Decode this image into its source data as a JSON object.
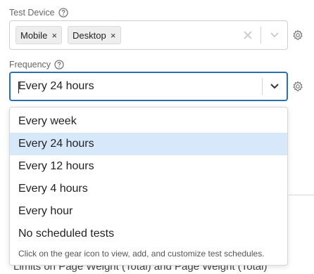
{
  "test_device": {
    "label": "Test Device",
    "tags": [
      "Mobile",
      "Desktop"
    ],
    "remove_glyph": "×"
  },
  "frequency": {
    "label": "Frequency",
    "value": "Every 24 hours",
    "options": [
      "Every week",
      "Every 24 hours",
      "Every 12 hours",
      "Every 4 hours",
      "Every hour",
      "No scheduled tests"
    ],
    "selected_index": 1,
    "hint": "Click on the gear icon to view, add, and customize test schedules."
  },
  "background_text": "Limits on Page Weight (Total) and Page Weight (Total)",
  "colors": {
    "focus_border": "#2c6fad",
    "selected_option_bg": "#d6e8fa"
  },
  "icons": {
    "help": "question-circle-icon",
    "gear": "gear-icon",
    "clear": "close-icon",
    "dropdown": "chevron-down-icon"
  }
}
